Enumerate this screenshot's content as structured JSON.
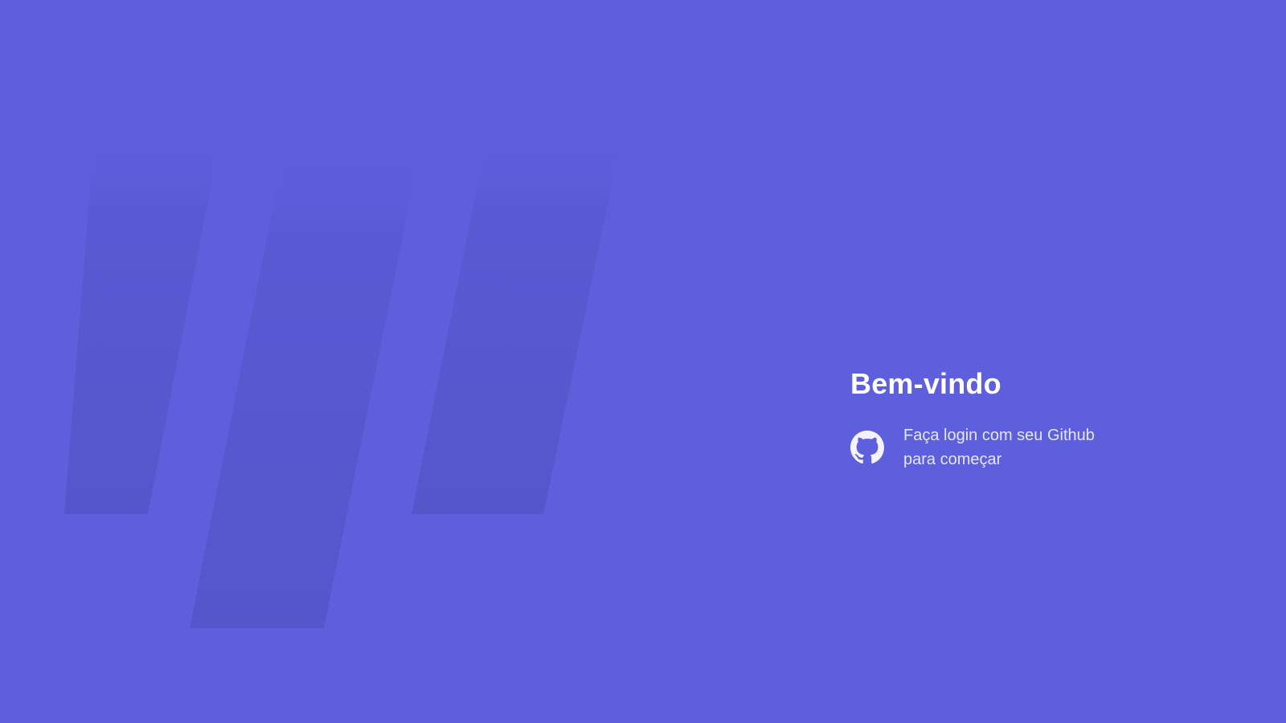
{
  "colors": {
    "background": "#5d5fdd",
    "quote_mark": "#5759d2",
    "title": "#ffffff",
    "login_text": "#e6e7ff"
  },
  "backdrop": {
    "icon": "quotation-marks-graphic"
  },
  "login": {
    "title": "Bem-vindo",
    "icon": "github-icon",
    "message": "Faça login com seu Github para começar"
  }
}
